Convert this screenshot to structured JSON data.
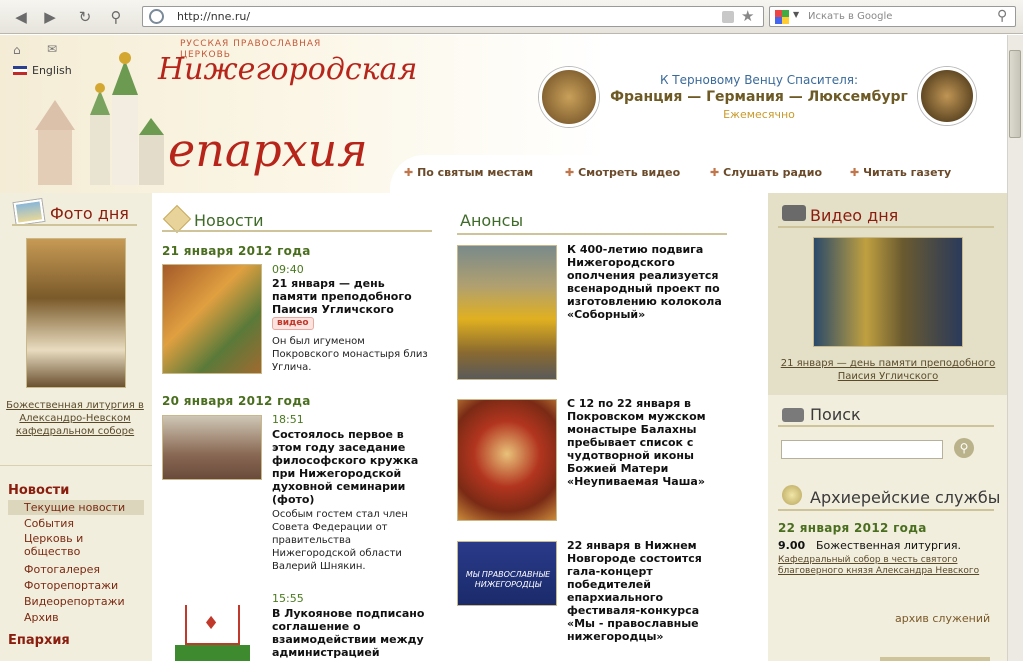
{
  "browser": {
    "url": "http://nne.ru/",
    "search_placeholder": "Искать в Google"
  },
  "header": {
    "top_links": {
      "english": "English"
    },
    "logo_small": "РУССКАЯ  ПРАВОСЛАВНАЯ ЦЕРКОВЬ",
    "logo_big_line1": "Нижегородская",
    "logo_big_line2": "епархия",
    "promo": {
      "line1": "К Терновому Венцу Спасителя:",
      "line2": "Франция — Германия — Люксембург",
      "line3": "Ежемесячно"
    },
    "nav": [
      "По святым местам",
      "Смотреть видео",
      "Слушать радио",
      "Читать газету"
    ]
  },
  "left": {
    "photo_title": "Фото дня",
    "photo_caption": "Божественная литургия в Александро-Невском кафедральном соборе",
    "menu_title": "Новости",
    "menu_items": [
      "Текущие новости",
      "События",
      "Церковь и общество",
      "Фотогалерея",
      "Фоторепортажи",
      "Видеорепортажи",
      "Архив"
    ],
    "menu_title2": "Епархия"
  },
  "news": {
    "title": "Новости",
    "groups": [
      {
        "date": "21 января 2012 года",
        "time": "09:40",
        "headline": "21 января — день памяти преподобного Паисия Угличского",
        "badge": "видео",
        "text": "Он был игуменом Покровского монастыря близ Углича."
      },
      {
        "date": "20 января 2012 года",
        "time": "18:51",
        "headline": "Состоялось первое в этом году заседание философского кружка при Нижегородской духовной семинарии (фото)",
        "badge": "",
        "text": "Особым гостем стал член Совета Федерации от правительства Нижегородской области Валерий Шнякин."
      },
      {
        "date": "",
        "time": "15:55",
        "headline": "В Лукоянове подписано соглашение о взаимодействии между администрацией",
        "badge": "",
        "text": ""
      }
    ]
  },
  "announces": {
    "title": "Анонсы",
    "items": [
      "К 400-летию подвига Нижегородского ополчения реализуется всенародный проект по изготовлению колокола «Соборный»",
      "С 12 по 22 января в Покровском мужском монастыре Балахны пребывает список с чудотворной иконы Божией Матери «Неупиваемая Чаша»",
      "22 января в Нижнем Новгороде состоится гала-концерт победителей епархиального фестиваля-конкурса «Мы - православные нижегородцы»"
    ],
    "banner_text": "МЫ ПРАВОСЛАВНЫЕ НИЖЕГОРОДЦЫ"
  },
  "right": {
    "video_title": "Видео дня",
    "video_caption": "21 января — день памяти преподобного Паисия Угличского",
    "search_title": "Поиск",
    "services_title": "Архиерейские службы",
    "services_date": "22 января 2012 года",
    "service_time": "9.00",
    "service_name": "Божественная литургия.",
    "service_place": "Кафедральный собор в честь святого благоверного князя Александра Невского",
    "archive": "архив служений"
  },
  "colors": {
    "accent_red": "#8a1d0e",
    "green": "#4a6e1f",
    "side_bg": "#f2eedd",
    "right_bg": "#e4e0c8"
  }
}
